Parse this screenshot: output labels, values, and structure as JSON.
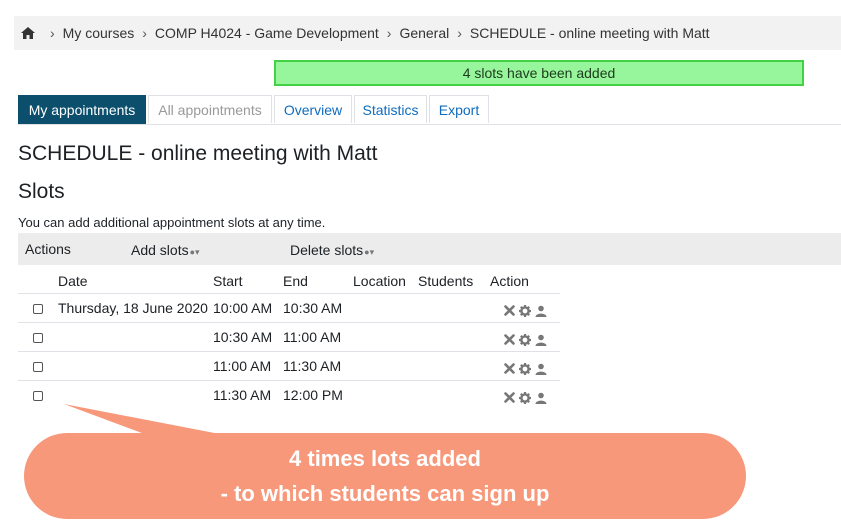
{
  "breadcrumb": {
    "items": [
      "My courses",
      "COMP H4024 - Game Development",
      "General",
      "SCHEDULE - online meeting with Matt"
    ]
  },
  "alert": {
    "text": "4 slots have been added",
    "color": "#97f59b"
  },
  "tabs": [
    {
      "label": "My appointments",
      "state": "active"
    },
    {
      "label": "All appointments",
      "state": "disabled"
    },
    {
      "label": "Overview",
      "state": "normal"
    },
    {
      "label": "Statistics",
      "state": "normal"
    },
    {
      "label": "Export",
      "state": "normal"
    }
  ],
  "page_title": "SCHEDULE - online meeting with Matt",
  "slots_heading": "Slots",
  "info_text": "You can add additional appointment slots at any time.",
  "actions_bar": {
    "label": "Actions",
    "add_slots": "Add slots",
    "delete_slots": "Delete slots"
  },
  "table": {
    "headers": {
      "date": "Date",
      "start": "Start",
      "end": "End",
      "location": "Location",
      "students": "Students",
      "action": "Action"
    },
    "rows": [
      {
        "date": "Thursday, 18 June 2020",
        "start": "10:00 AM",
        "end": "10:30 AM",
        "location": "",
        "students": ""
      },
      {
        "date": "",
        "start": "10:30 AM",
        "end": "11:00 AM",
        "location": "",
        "students": ""
      },
      {
        "date": "",
        "start": "11:00 AM",
        "end": "11:30 AM",
        "location": "",
        "students": ""
      },
      {
        "date": "",
        "start": "11:30 AM",
        "end": "12:00 PM",
        "location": "",
        "students": ""
      }
    ],
    "row_action_icons": [
      "delete-icon",
      "settings-icon",
      "user-icon"
    ]
  },
  "callout": {
    "line1": "4 times lots added",
    "line2": "- to which students can sign up",
    "color": "#f7987a"
  },
  "colors": {
    "active_tab": "#0b4f6c",
    "link": "#0f6cbf"
  }
}
